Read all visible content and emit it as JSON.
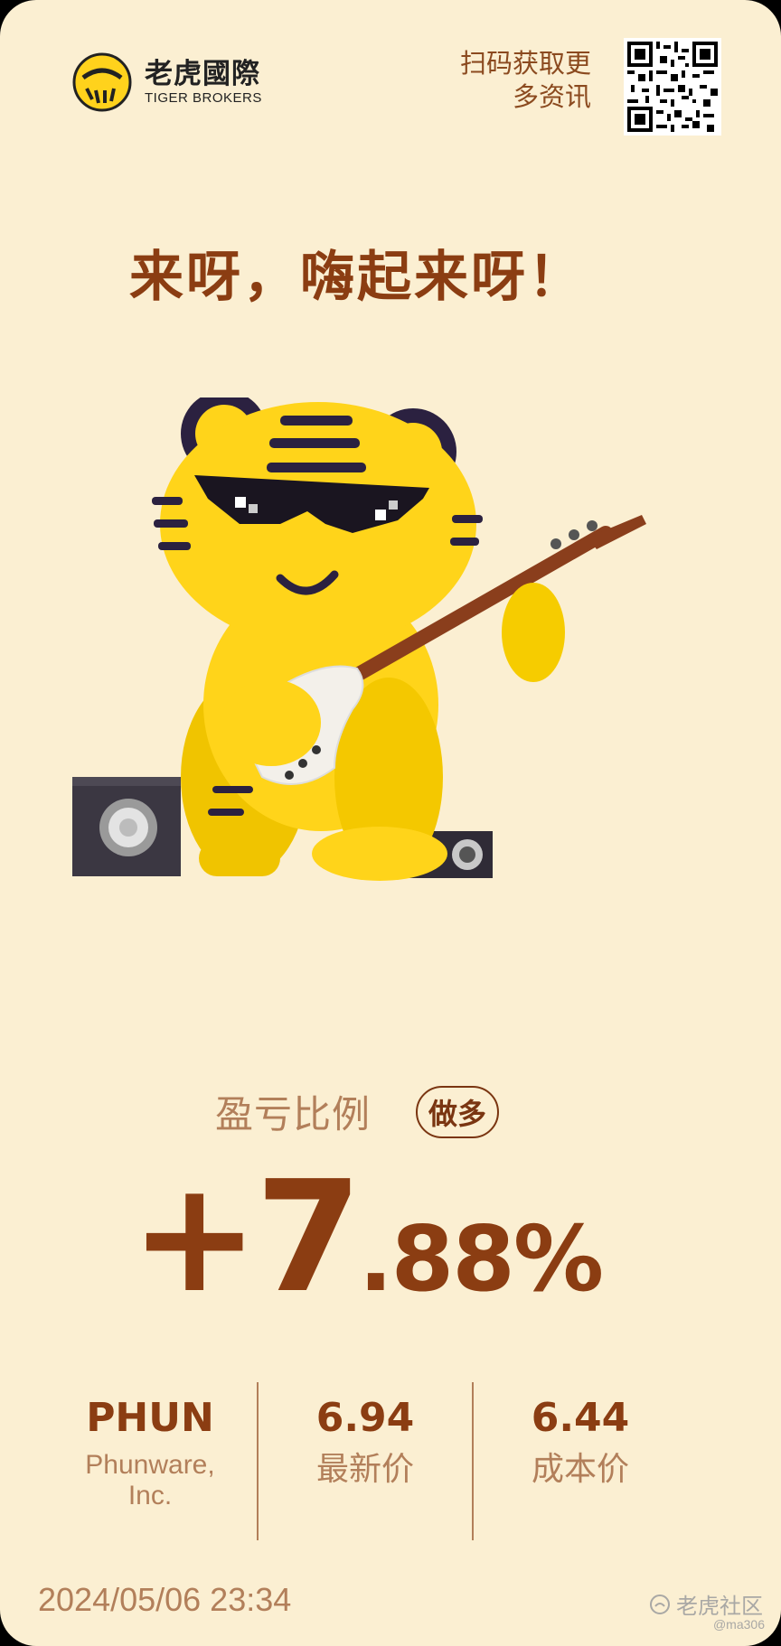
{
  "brand": {
    "name_cn": "老虎國際",
    "name_en": "TIGER BROKERS"
  },
  "scan_prompt": {
    "line1": "扫码获取更",
    "line2": "多资讯"
  },
  "headline": "来呀，嗨起来呀！",
  "pnl": {
    "label": "盈亏比例",
    "direction": "做多",
    "sign_int": "+7",
    "decimal": ".88%"
  },
  "stats": {
    "ticker": "PHUN",
    "company_line1": "Phunware,",
    "company_line2": "Inc.",
    "latest_price": "6.94",
    "latest_label": "最新价",
    "cost_price": "6.44",
    "cost_label": "成本价"
  },
  "timestamp": "2024/05/06 23:34",
  "watermark": {
    "community": "老虎社区",
    "user": "@ma306"
  },
  "colors": {
    "background": "#fbefd2",
    "accent": "#8b3d12",
    "muted": "#b27f5a",
    "brand_yellow": "#ffd21c"
  },
  "icons": {
    "logo": "tiger-logo-icon",
    "qr": "qr-code-icon",
    "mascot": "tiger-guitar-mascot",
    "watermark": "community-logo-icon"
  }
}
